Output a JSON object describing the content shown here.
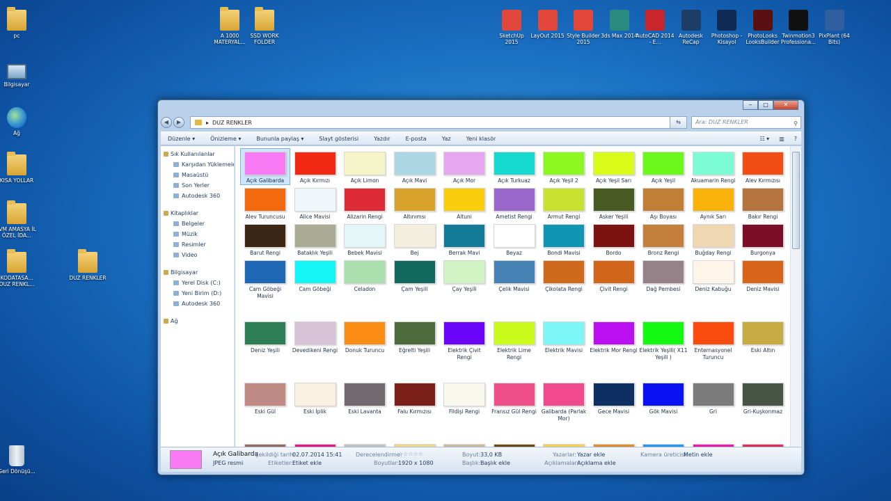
{
  "desktop": {
    "left_icons": [
      {
        "label": "pc"
      },
      {
        "label": "Bilgisayar"
      },
      {
        "label": "Ağ"
      },
      {
        "label": "KISA YOLLAR"
      },
      {
        "label": "İVM AMASYA İL ÖZEL İDA..."
      },
      {
        "label": "KODATASA... DUZ RENKL..."
      },
      {
        "label": "Geri Dönüşü..."
      }
    ],
    "folders": [
      {
        "label": "A 1000 MATERYAL..."
      },
      {
        "label": "SSD WORK FOLDER"
      },
      {
        "label": "DUZ RENKLER"
      }
    ],
    "apps": [
      {
        "label": "SketchUp 2015",
        "color": "#e2473c"
      },
      {
        "label": "LayOut 2015",
        "color": "#e2473c"
      },
      {
        "label": "Style Builder 2015",
        "color": "#e2473c"
      },
      {
        "label": "3ds Max 2014",
        "color": "#2b8a7f"
      },
      {
        "label": "AutoCAD 2014 - E...",
        "color": "#c8262b"
      },
      {
        "label": "Autodesk ReCap",
        "color": "#1e3d66"
      },
      {
        "label": "Photoshop - Kisayol",
        "color": "#0e2a55"
      },
      {
        "label": "PhotoLooks LooksBuilder",
        "color": "#5a1010"
      },
      {
        "label": "Twinmotion3 Professiona...",
        "color": "#111111"
      },
      {
        "label": "PixPlant (64 Bits)",
        "color": "#2f5f9e"
      }
    ]
  },
  "window": {
    "buttons": {
      "minimize": "‒",
      "maximize": "□",
      "close": "✕"
    },
    "address": {
      "back": "◀",
      "forward": "▶",
      "path": "DUZ RENKLER",
      "sep": "▸",
      "refresh": "⇆"
    },
    "search": {
      "placeholder": "Ara: DUZ RENKLER",
      "icon": "⚲"
    },
    "toolbar": {
      "items": [
        "Düzenle ▾",
        "Önizleme ▾",
        "Bununla paylaş ▾",
        "Slayt gösterisi",
        "Yazdır",
        "E-posta",
        "Yaz",
        "Yeni klasör"
      ],
      "view_icon": "☷ ▾",
      "pane_icon": "▥",
      "help_icon": "?"
    },
    "nav": {
      "favorites": "Sık Kullanılanlar",
      "favorites_items": [
        "Karşıdan Yüklemeler",
        "Masaüstü",
        "Son Yerler",
        "Autodesk 360"
      ],
      "libraries": "Kitaplıklar",
      "libraries_items": [
        "Belgeler",
        "Müzik",
        "Resimler",
        "Video"
      ],
      "computer": "Bilgisayar",
      "computer_items": [
        "Yerel Disk (C:)",
        "Yeni Birim (D:)",
        "Autodesk 360"
      ],
      "network": "Ağ"
    },
    "files": [
      {
        "name": "Açık Galibarda",
        "color": "#f97af5"
      },
      {
        "name": "Açık Kırmızı",
        "color": "#f22a14"
      },
      {
        "name": "Açık Limon",
        "color": "#f5f5c8"
      },
      {
        "name": "Açık Mavi",
        "color": "#acd7e4"
      },
      {
        "name": "Açık Mor",
        "color": "#e6a6f0"
      },
      {
        "name": "Açık Turkuaz",
        "color": "#16d9cf"
      },
      {
        "name": "Açık Yeşil 2",
        "color": "#8cf81f"
      },
      {
        "name": "Açık Yeşil Sarı",
        "color": "#d9fb18"
      },
      {
        "name": "Açık Yeşil",
        "color": "#6cf81a"
      },
      {
        "name": "Akuamarin Rengi",
        "color": "#7bfcd2"
      },
      {
        "name": "Alev Kırmızısı",
        "color": "#f24d13"
      },
      {
        "name": "Alev Turuncusu",
        "color": "#f2690e"
      },
      {
        "name": "Alice Mavisi",
        "color": "#eff7fa"
      },
      {
        "name": "Alizarin Rengi",
        "color": "#dd2a34"
      },
      {
        "name": "Altınımsı",
        "color": "#d9a22a"
      },
      {
        "name": "Altuni",
        "color": "#fbce0d"
      },
      {
        "name": "Ametist Rengi",
        "color": "#9966cc"
      },
      {
        "name": "Armut Rengi",
        "color": "#c9e22f"
      },
      {
        "name": "Asker Yeşili",
        "color": "#4a5a23"
      },
      {
        "name": "Aşı Boyası",
        "color": "#c17e36"
      },
      {
        "name": "Aynık Sarı",
        "color": "#f8b20a"
      },
      {
        "name": "Bakır Rengi",
        "color": "#b5733e"
      },
      {
        "name": "Barut Rengi",
        "color": "#3c2716"
      },
      {
        "name": "Bataklık Yeşili",
        "color": "#aaab95"
      },
      {
        "name": "Bebek Mavisi",
        "color": "#e3f7f9"
      },
      {
        "name": "Bej",
        "color": "#f3eedd"
      },
      {
        "name": "Berrak Mavi",
        "color": "#137b97"
      },
      {
        "name": "Beyaz",
        "color": "#ffffff"
      },
      {
        "name": "Bondi Mavisi",
        "color": "#1096b4"
      },
      {
        "name": "Bordo",
        "color": "#7d1213"
      },
      {
        "name": "Bronz Rengi",
        "color": "#c57f3c"
      },
      {
        "name": "Buğday Rengi",
        "color": "#efd8b1"
      },
      {
        "name": "Burgonya",
        "color": "#7c0e2a"
      },
      {
        "name": "Cam Göbeği Mavisi",
        "color": "#1f68b5"
      },
      {
        "name": "Cam Göbeği",
        "color": "#14f6f6"
      },
      {
        "name": "Celadon",
        "color": "#abdfad"
      },
      {
        "name": "Çam Yeşili",
        "color": "#126a5e"
      },
      {
        "name": "Çay Yeşili",
        "color": "#cff3c3"
      },
      {
        "name": "Çelik Mavisi",
        "color": "#4681b3"
      },
      {
        "name": "Çikolata Rengi",
        "color": "#cf6a1c"
      },
      {
        "name": "Çivit Rengi",
        "color": "#d1661b"
      },
      {
        "name": "Dağ Pembesi",
        "color": "#968188"
      },
      {
        "name": "Deniz Kabuğu",
        "color": "#fdf5ea"
      },
      {
        "name": "Deniz Mavisi",
        "color": "#d7661a"
      },
      {
        "name": "Deniz Yeşili",
        "color": "#2e7e56"
      },
      {
        "name": "Devedikeni Rengi",
        "color": "#d8c3d6"
      },
      {
        "name": "Donuk Turuncu",
        "color": "#fb8c14"
      },
      {
        "name": "Eğrelti Yeşili",
        "color": "#4d6b3d"
      },
      {
        "name": "Elektrik Çivit Rengi",
        "color": "#6a05f9"
      },
      {
        "name": "Elektrik Lime Rengi",
        "color": "#cbfb1c"
      },
      {
        "name": "Elektrik Mavisi",
        "color": "#7df6f7"
      },
      {
        "name": "Elektrik Mor Rengi",
        "color": "#bb10f1"
      },
      {
        "name": "Elektrik Yeşili( X11 Yeşili )",
        "color": "#14f812"
      },
      {
        "name": "Enternasyonel Turuncu",
        "color": "#fa4c0e"
      },
      {
        "name": "Eski Altın",
        "color": "#c7ac44"
      },
      {
        "name": "Eski Gül",
        "color": "#c08a84"
      },
      {
        "name": "Eski İplik",
        "color": "#f9f0df"
      },
      {
        "name": "Eski Lavanta",
        "color": "#716970"
      },
      {
        "name": "Falu Kırmızısı",
        "color": "#7b1f1a"
      },
      {
        "name": "Fildişi Rengi",
        "color": "#f8f8ee"
      },
      {
        "name": "Fransız Gül Rengi",
        "color": "#f0508a"
      },
      {
        "name": "Galibarda (Parlak Mor)",
        "color": "#f0498d"
      },
      {
        "name": "Gece Mavisi",
        "color": "#0e2f62"
      },
      {
        "name": "Gök Mavisi",
        "color": "#0a11f3"
      },
      {
        "name": "Gri",
        "color": "#7b7b7b"
      },
      {
        "name": "Gri-Kuşkonmaz",
        "color": "#465546"
      },
      {
        "name": "",
        "color": "#8e6b65"
      },
      {
        "name": "",
        "color": "#e8148a"
      },
      {
        "name": "",
        "color": "#c2c2c2"
      },
      {
        "name": "",
        "color": "#eed986"
      },
      {
        "name": "",
        "color": "#c8bba0"
      },
      {
        "name": "",
        "color": "#6e4718"
      },
      {
        "name": "",
        "color": "#f4d14b"
      },
      {
        "name": "",
        "color": "#e08c2c"
      },
      {
        "name": "",
        "color": "#2196f3"
      },
      {
        "name": "",
        "color": "#ef17a5"
      },
      {
        "name": "",
        "color": "#e12a55"
      }
    ],
    "details": {
      "name": "Açık Galibarda",
      "type": "JPEG resmi",
      "thumb_color": "#f97af5",
      "taken_label": "Çekildiği tarih:",
      "taken": "02.07.2014 15:41",
      "tags_label": "Etiketler:",
      "tags": "Etiket ekle",
      "rating_label": "Derecelendirme:",
      "rating": "☆☆☆☆☆",
      "dims_label": "Boyutlar:",
      "dims": "1920 x 1080",
      "size_label": "Boyut:",
      "size": "33,0 KB",
      "title_label": "Başlık:",
      "title": "Başlık ekle",
      "authors_label": "Yazarlar:",
      "authors": "Yazar ekle",
      "comments_label": "Açıklamalar:",
      "comments": "Açıklama ekle",
      "camera_label": "Kamera üreticisi:",
      "camera": "Metin ekle"
    }
  }
}
